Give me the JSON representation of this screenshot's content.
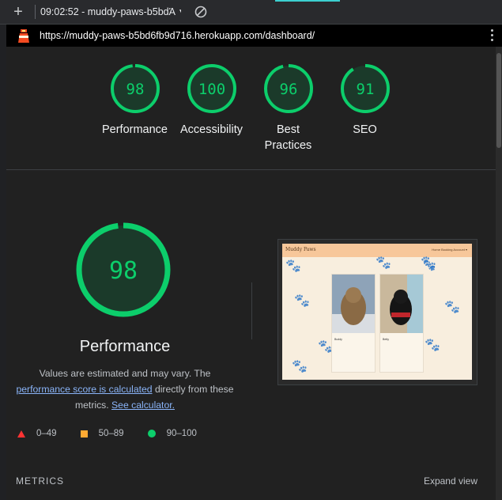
{
  "toolbar": {
    "add_icon": "plus-icon",
    "session_label": "09:02:52 - muddy-paws-b5bdΆ",
    "block_icon": "block-icon"
  },
  "urlbar": {
    "url": "https://muddy-paws-b5bd6fb9d716.herokuapp.com/dashboard/"
  },
  "categories": [
    {
      "score": "98",
      "label": "Performance"
    },
    {
      "score": "100",
      "label": "Accessibility"
    },
    {
      "score": "96",
      "label": "Best Practices"
    },
    {
      "score": "91",
      "label": "SEO"
    }
  ],
  "performance": {
    "score": "98",
    "title": "Performance",
    "desc_1": "Values are estimated and may vary. The",
    "link_1": "performance score is calculated",
    "desc_2": "directly from these metrics.",
    "link_2": "See calculator."
  },
  "screenshot": {
    "brand": "Muddy Paws",
    "nav": "Home  Booking  Account ▾",
    "pet_1": "Buddy",
    "pet_2": "Betty"
  },
  "legend": {
    "fail": "0–49",
    "average": "50–89",
    "pass": "90–100"
  },
  "metrics": {
    "heading": "METRICS",
    "expand": "Expand view"
  },
  "colors": {
    "pass": "#0cce6b",
    "pass_fill": "#1b3a2a",
    "average": "#ffaa33",
    "fail": "#ff3333",
    "link": "#8ab4f8"
  }
}
